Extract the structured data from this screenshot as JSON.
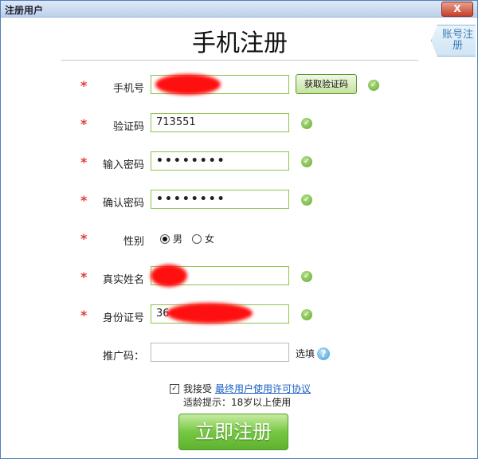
{
  "window": {
    "title": "注册用户",
    "close_label": "X"
  },
  "page": {
    "title": "手机注册",
    "side_tab": "账号注册"
  },
  "form": {
    "required_mark": "*",
    "phone": {
      "label": "手机号",
      "value": "",
      "captcha_button": "获取验证码"
    },
    "captcha": {
      "label": "验证码",
      "value": "713551"
    },
    "password": {
      "label": "输入密码",
      "value": "••••••••"
    },
    "confirm": {
      "label": "确认密码",
      "value": "••••••••"
    },
    "gender": {
      "label": "性别",
      "options": [
        "男",
        "女"
      ],
      "selected": "男"
    },
    "realname": {
      "label": "真实姓名",
      "value": ""
    },
    "idnumber": {
      "label": "身份证号",
      "value": "36"
    },
    "promo": {
      "label": "推广码：",
      "value": "",
      "optional_label": "选填"
    }
  },
  "agreement": {
    "checked": true,
    "text": "我接受",
    "link": "最终用户使用许可协议",
    "age_tip": "适龄提示：18岁以上使用"
  },
  "submit_label": "立即注册",
  "icons": {
    "valid": "check-icon",
    "help": "help-icon"
  },
  "colors": {
    "accent_green": "#76c743",
    "required_red": "#e23b3b",
    "link_blue": "#1a5fc4"
  }
}
